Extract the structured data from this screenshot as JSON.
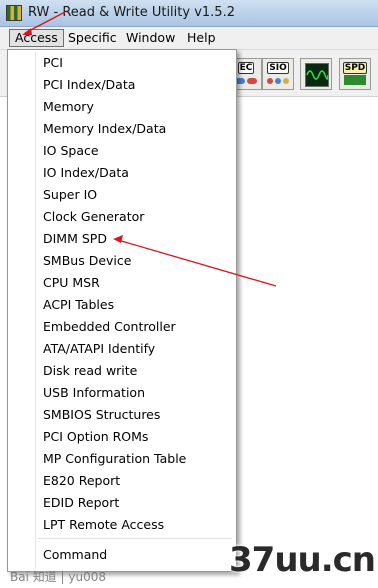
{
  "window": {
    "title": "RW - Read & Write Utility v1.5.2",
    "app_icon": "rw-app-icon"
  },
  "menubar": {
    "items": [
      "Access",
      "Specific",
      "Window",
      "Help"
    ],
    "active": "Access"
  },
  "toolbar": {
    "buttons": [
      {
        "name": "ec-button",
        "label": "EC",
        "icon": "chip-icon"
      },
      {
        "name": "sio-button",
        "label": "SIO",
        "icon": "sio-chip-icon"
      },
      {
        "name": "scope-button",
        "label": "",
        "icon": "oscilloscope-icon"
      },
      {
        "name": "spd-button",
        "label": "SPD",
        "icon": "spd-memory-icon"
      }
    ]
  },
  "access_menu": {
    "items": [
      "PCI",
      "PCI Index/Data",
      "Memory",
      "Memory Index/Data",
      "IO Space",
      "IO Index/Data",
      "Super IO",
      "Clock Generator",
      "DIMM SPD",
      "SMBus Device",
      "CPU MSR",
      "ACPI Tables",
      "Embedded Controller",
      "ATA/ATAPI Identify",
      "Disk read write",
      "USB Information",
      "SMBIOS Structures",
      "PCI Option ROMs",
      "MP Configuration Table",
      "E820 Report",
      "EDID Report",
      "LPT Remote Access"
    ],
    "command_item": "Command",
    "highlighted": "DIMM SPD"
  },
  "annotation": {
    "color": "#d8141e"
  },
  "watermark": {
    "text": "37uu.cn",
    "baidu": "Bai 知道 | yu008"
  }
}
